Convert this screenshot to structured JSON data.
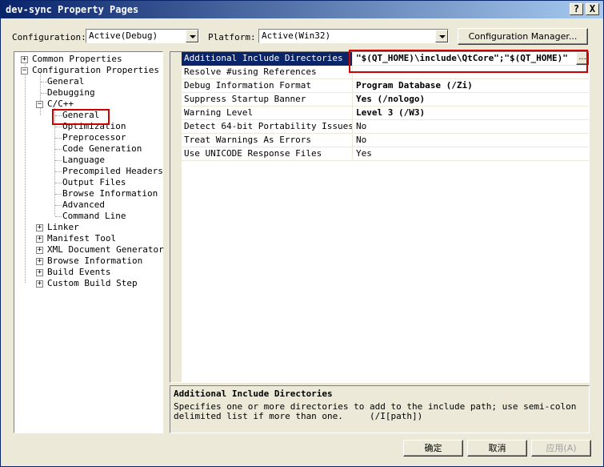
{
  "window": {
    "title": "dev-sync Property Pages",
    "help_btn": "?",
    "close_btn": "X"
  },
  "config_bar": {
    "configuration_label": "Configuration:",
    "configuration_value": "Active(Debug)",
    "platform_label": "Platform:",
    "platform_value": "Active(Win32)",
    "manager_btn": "Configuration Manager..."
  },
  "tree": {
    "common": "Common Properties",
    "config_props": "Configuration Properties",
    "general": "General",
    "debugging": "Debugging",
    "cpp": "C/C++",
    "cpp_children": [
      "General",
      "Optimization",
      "Preprocessor",
      "Code Generation",
      "Language",
      "Precompiled Headers",
      "Output Files",
      "Browse Information",
      "Advanced",
      "Command Line"
    ],
    "others": [
      "Linker",
      "Manifest Tool",
      "XML Document Generator",
      "Browse Information",
      "Build Events",
      "Custom Build Step"
    ]
  },
  "grid": [
    {
      "name": "Additional Include Directories",
      "value": "\"$(QT_HOME)\\include\\QtCore\";\"$(QT_HOME)\"",
      "bold": true
    },
    {
      "name": "Resolve #using References",
      "value": "",
      "bold": false
    },
    {
      "name": "Debug Information Format",
      "value": "Program Database (/Zi)",
      "bold": true
    },
    {
      "name": "Suppress Startup Banner",
      "value": "Yes (/nologo)",
      "bold": true
    },
    {
      "name": "Warning Level",
      "value": "Level 3 (/W3)",
      "bold": true
    },
    {
      "name": "Detect 64-bit Portability Issues",
      "value": "No",
      "bold": false
    },
    {
      "name": "Treat Warnings As Errors",
      "value": "No",
      "bold": false
    },
    {
      "name": "Use UNICODE Response Files",
      "value": "Yes",
      "bold": false
    }
  ],
  "ellipsis_btn": "...",
  "description": {
    "title": "Additional Include Directories",
    "text": "Specifies one or more directories to add to the include path; use semi-colon",
    "text2": "delimited list if more than one.     (/I[path])"
  },
  "buttons": {
    "ok": "确定",
    "cancel": "取消",
    "apply": "应用(A)"
  },
  "colors": {
    "selection": "#0a246a",
    "highlight": "#d00000",
    "face": "#ece9d8"
  }
}
